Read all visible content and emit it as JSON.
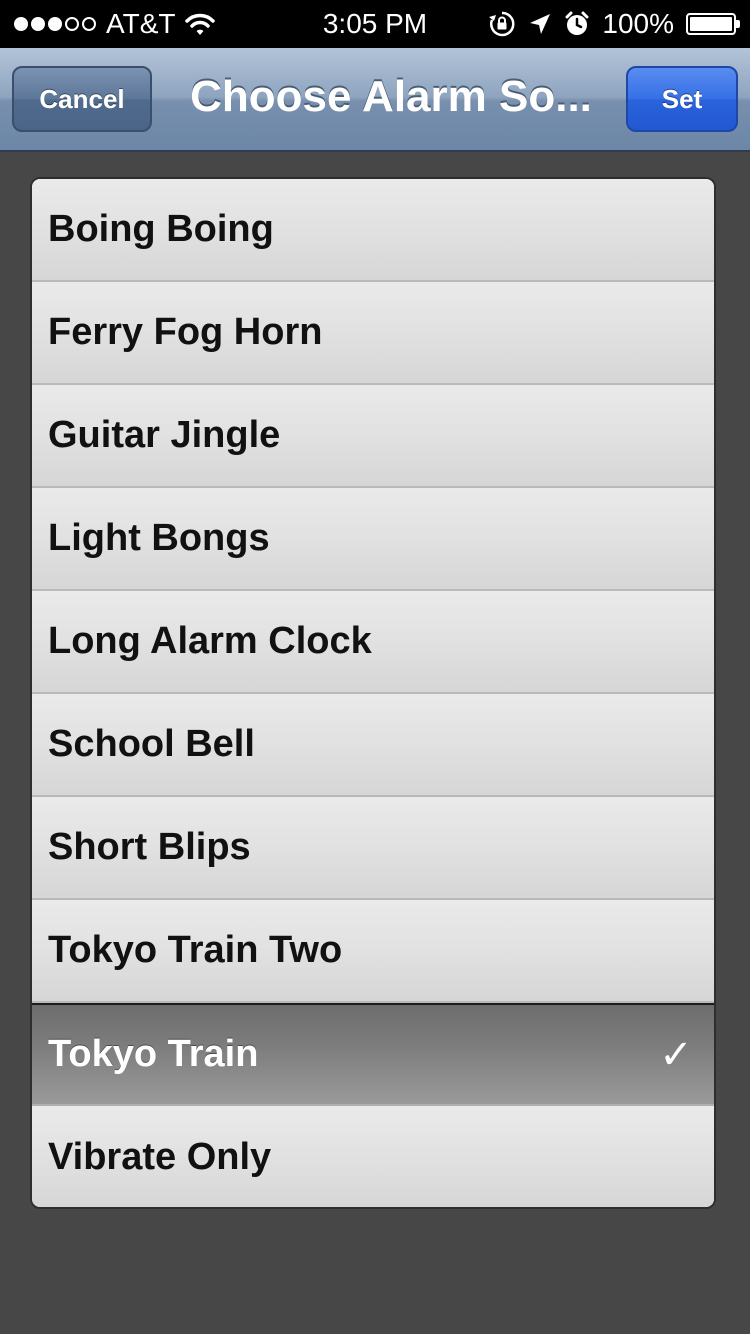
{
  "status_bar": {
    "signal_bars_filled": 3,
    "signal_bars_total": 5,
    "carrier": "AT&T",
    "time": "3:05 PM",
    "battery_pct": "100%",
    "battery_level": 1.0
  },
  "nav": {
    "cancel_label": "Cancel",
    "title": "Choose Alarm So...",
    "set_label": "Set"
  },
  "sounds": {
    "items": [
      {
        "label": "Boing Boing",
        "selected": false
      },
      {
        "label": "Ferry Fog Horn",
        "selected": false
      },
      {
        "label": "Guitar Jingle",
        "selected": false
      },
      {
        "label": "Light Bongs",
        "selected": false
      },
      {
        "label": "Long Alarm Clock",
        "selected": false
      },
      {
        "label": "School Bell",
        "selected": false
      },
      {
        "label": "Short Blips",
        "selected": false
      },
      {
        "label": "Tokyo Train Two",
        "selected": false
      },
      {
        "label": "Tokyo Train",
        "selected": true
      },
      {
        "label": "Vibrate Only",
        "selected": false
      }
    ],
    "check_glyph": "✓"
  },
  "colors": {
    "nav_accent": "#6c86a7",
    "set_button": "#2a63dc",
    "selected_row": "#7c7c7c"
  }
}
